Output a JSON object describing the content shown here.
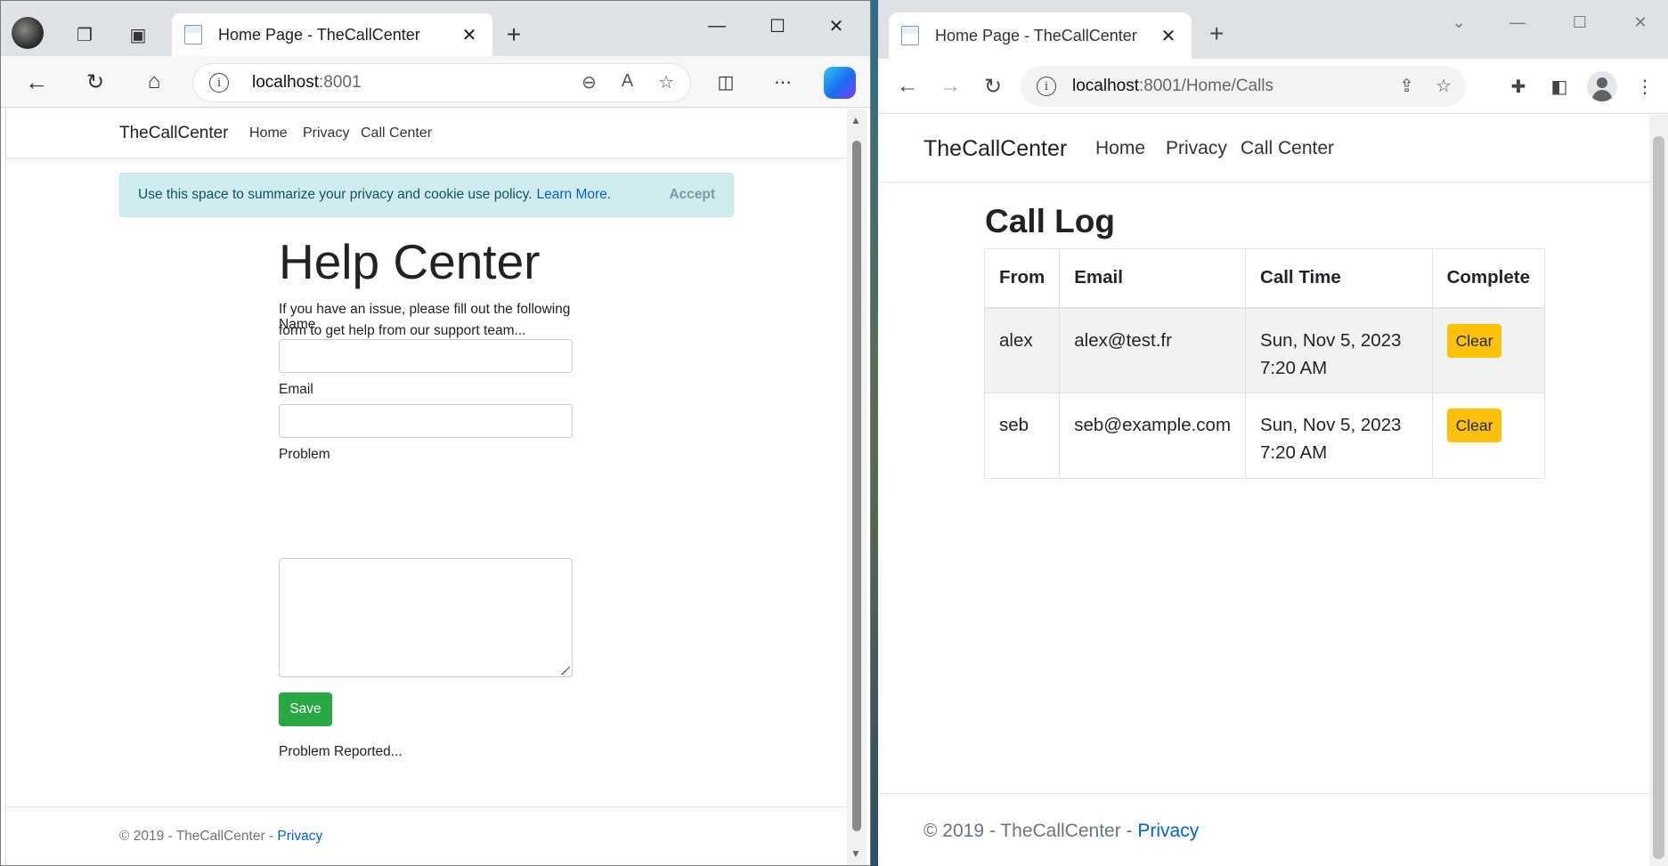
{
  "left_browser": {
    "tab_title": "Home Page - TheCallCenter",
    "address": {
      "host": "localhost",
      "port": ":8001"
    },
    "page": {
      "brand": "TheCallCenter",
      "nav": [
        "Home",
        "Privacy",
        "Call Center"
      ],
      "cookie": {
        "text": "Use this space to summarize your privacy and cookie use policy.",
        "link": "Learn More.",
        "accept": "Accept"
      },
      "heading": "Help Center",
      "intro": "If you have an issue, please fill out the following form to get help from our support team...",
      "form": {
        "name_label": "Name",
        "name_value": "",
        "email_label": "Email",
        "email_value": "",
        "problem_label": "Problem",
        "problem_value": "",
        "save_label": "Save"
      },
      "status": "Problem Reported...",
      "footer": {
        "text": "© 2019 - TheCallCenter - ",
        "link": "Privacy"
      }
    }
  },
  "right_browser": {
    "tab_title": "Home Page - TheCallCenter",
    "address": {
      "host": "localhost",
      "path": ":8001/Home/Calls"
    },
    "page": {
      "brand": "TheCallCenter",
      "nav": [
        "Home",
        "Privacy",
        "Call Center"
      ],
      "heading": "Call Log",
      "table": {
        "headers": [
          "From",
          "Email",
          "Call Time",
          "Complete"
        ],
        "rows": [
          {
            "from": "alex",
            "email": "alex@test.fr",
            "date": "Sun, Nov 5, 2023",
            "time": "7:20 AM",
            "action": "Clear"
          },
          {
            "from": "seb",
            "email": "seb@example.com",
            "date": "Sun, Nov 5, 2023",
            "time": "7:20 AM",
            "action": "Clear"
          }
        ]
      },
      "footer": {
        "text": "© 2019 - TheCallCenter - ",
        "link": "Privacy"
      }
    }
  },
  "colors": {
    "success": "#28a745",
    "warning": "#ffc107",
    "info_bg": "#d1ecf1",
    "link": "#0062cc"
  }
}
